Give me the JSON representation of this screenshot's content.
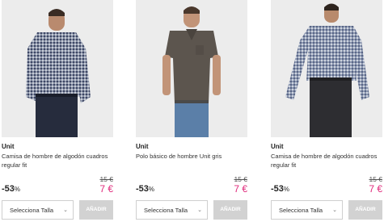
{
  "products": [
    {
      "brand": "Unit",
      "name": "Camisa de hombre de algodón cuadros regular fit",
      "old_price": "15 €",
      "discount": "-53",
      "discount_unit": "%",
      "new_price": "7 €",
      "size_select": "Selecciona Talla",
      "add_label": "AÑADIR",
      "image": "man-in-checked-shirt"
    },
    {
      "brand": "Unit",
      "name": "Polo básico de hombre Unit gris",
      "old_price": "15 €",
      "discount": "-53",
      "discount_unit": "%",
      "new_price": "7 €",
      "size_select": "Selecciona Talla",
      "add_label": "AÑADIR",
      "image": "man-in-gray-polo"
    },
    {
      "brand": "Unit",
      "name": "Camisa de hombre de algodón cuadros regular fit",
      "old_price": "15 €",
      "discount": "-53",
      "discount_unit": "%",
      "new_price": "7 €",
      "size_select": "Selecciona Talla",
      "add_label": "AÑADIR",
      "image": "man-in-checked-shirt"
    }
  ],
  "colors": {
    "sale_price": "#e0297b",
    "add_button_bg": "#d2d2d2",
    "photo_bg": "#ececec"
  },
  "icons": {
    "select_chevron": "chevron-down-icon"
  }
}
